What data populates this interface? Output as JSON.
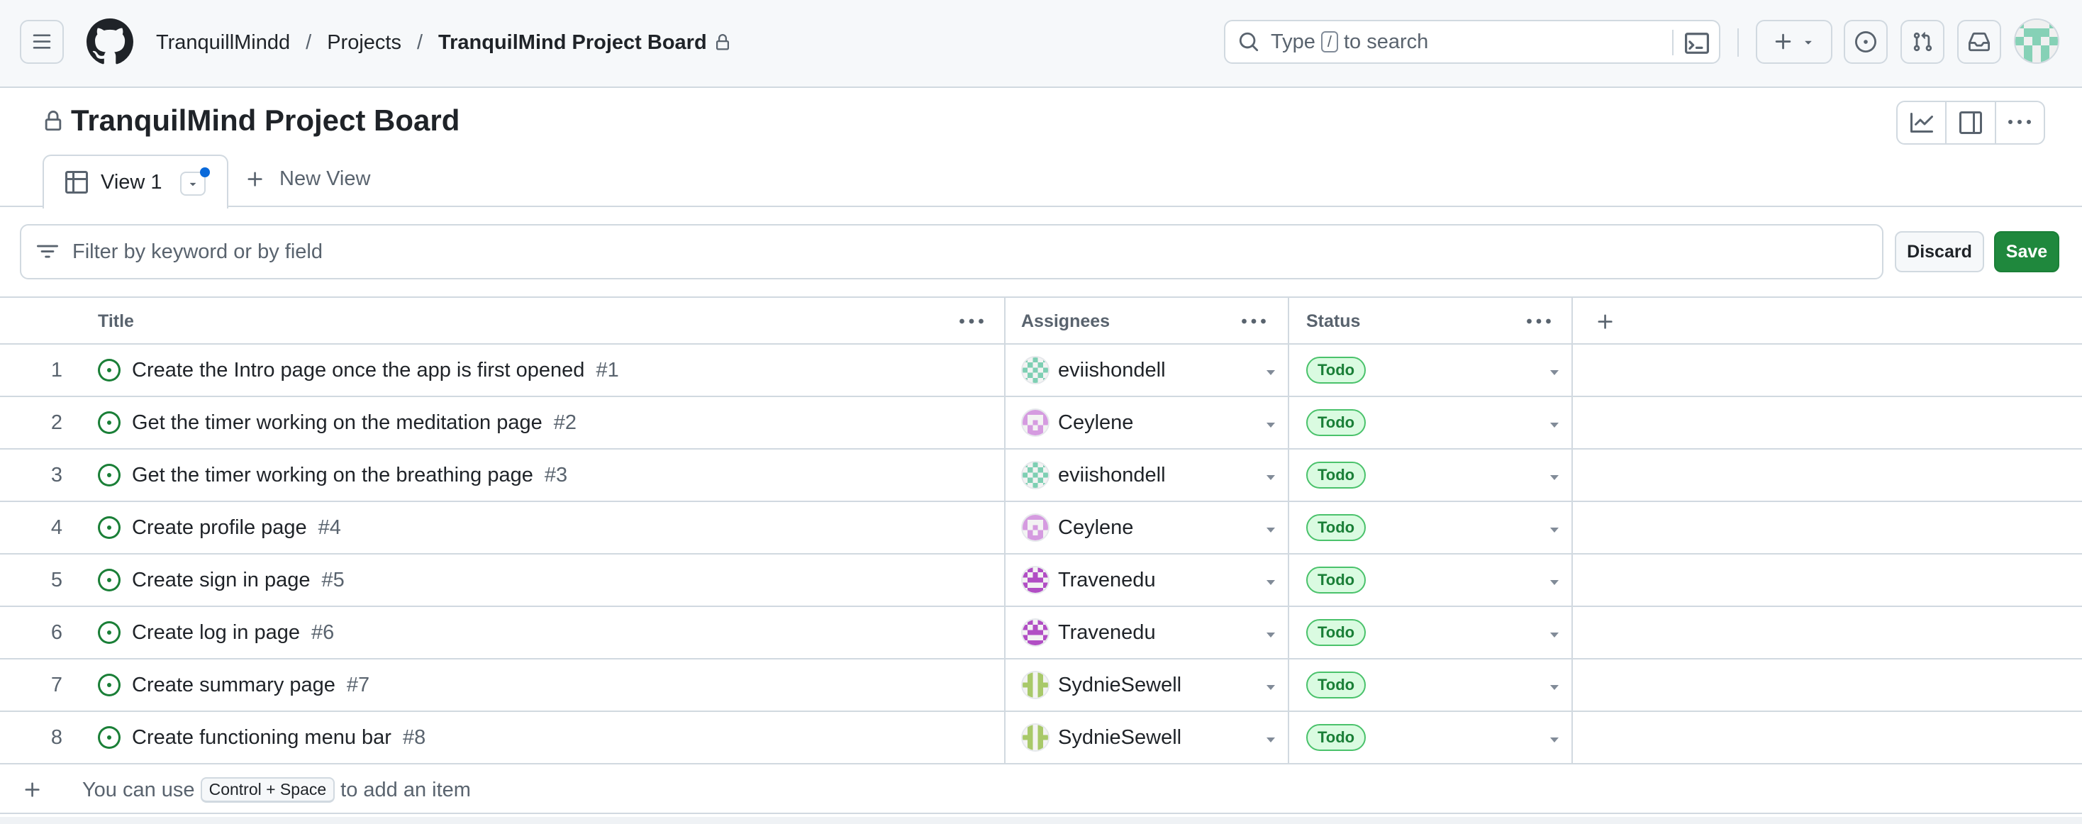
{
  "header": {
    "breadcrumb": {
      "owner": "TranquillMindd",
      "section": "Projects",
      "project": "TranquilMind Project Board"
    },
    "search": {
      "prefix": "Type",
      "key": "/",
      "suffix": "to search"
    }
  },
  "project": {
    "title": "TranquilMind Project Board"
  },
  "views": {
    "active_tab": "View 1",
    "new_view": "New View"
  },
  "filter": {
    "placeholder": "Filter by keyword or by field"
  },
  "actions": {
    "discard": "Discard",
    "save": "Save"
  },
  "table": {
    "columns": {
      "title": "Title",
      "assignees": "Assignees",
      "status": "Status"
    },
    "rows": [
      {
        "num": "1",
        "title": "Create the Intro page once the app is first opened",
        "issue": "#1",
        "assignee": "eviishondell",
        "status": "Todo"
      },
      {
        "num": "2",
        "title": "Get the timer working on the meditation page",
        "issue": "#2",
        "assignee": "Ceylene",
        "status": "Todo"
      },
      {
        "num": "3",
        "title": "Get the timer working on the breathing page",
        "issue": "#3",
        "assignee": "eviishondell",
        "status": "Todo"
      },
      {
        "num": "4",
        "title": "Create profile page",
        "issue": "#4",
        "assignee": "Ceylene",
        "status": "Todo"
      },
      {
        "num": "5",
        "title": "Create sign in page",
        "issue": "#5",
        "assignee": "Travenedu",
        "status": "Todo"
      },
      {
        "num": "6",
        "title": "Create log in page",
        "issue": "#6",
        "assignee": "Travenedu",
        "status": "Todo"
      },
      {
        "num": "7",
        "title": "Create summary page",
        "issue": "#7",
        "assignee": "SydnieSewell",
        "status": "Todo"
      },
      {
        "num": "8",
        "title": "Create functioning menu bar",
        "issue": "#8",
        "assignee": "SydnieSewell",
        "status": "Todo"
      }
    ],
    "add_hint": {
      "prefix": "You can use",
      "shortcut": "Control + Space",
      "suffix": "to add an item"
    }
  },
  "colors": {
    "accent": "#1f883d",
    "open_issue": "#1a7f37",
    "border": "#d1d9e0",
    "blue_dot": "#0969da"
  }
}
